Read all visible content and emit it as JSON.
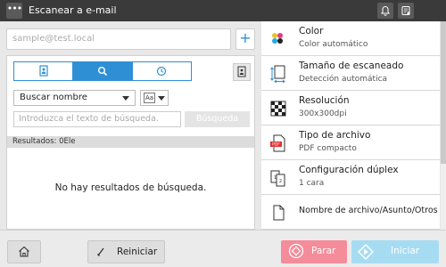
{
  "header": {
    "menu_glyph": "•••",
    "title": "Escanear a e-mail",
    "icons": [
      "bell-icon",
      "device-status-icon"
    ]
  },
  "destination": {
    "email_placeholder": "sample@test.local",
    "add_label": "+"
  },
  "search": {
    "tabs": [
      {
        "icon": "address-book-icon",
        "active": false
      },
      {
        "icon": "search-icon",
        "active": true
      },
      {
        "icon": "clock-icon",
        "active": false
      }
    ],
    "search_type": "Buscar nombre",
    "case_label": "Aa",
    "query_placeholder": "Introduzca el texto de búsqueda.",
    "search_button": "Búsqueda",
    "results_label": "Resultados: 0Ele",
    "no_results": "No hay resultados de búsqueda."
  },
  "settings": [
    {
      "name": "Color",
      "value": "Color automático",
      "icon": "color-icon"
    },
    {
      "name": "Tamaño de escaneado",
      "value": "Detección automática",
      "icon": "scan-size-icon"
    },
    {
      "name": "Resolución",
      "value": "300x300dpi",
      "icon": "resolution-icon"
    },
    {
      "name": "Tipo de archivo",
      "value": "PDF compacto",
      "icon": "file-type-icon",
      "badge": "PDF"
    },
    {
      "name": "Configuración dúplex",
      "value": "1 cara",
      "icon": "duplex-icon"
    },
    {
      "name": "Nombre de archivo/Asunto/Otros",
      "icon": "document-icon"
    }
  ],
  "footer": {
    "home_icon": "home-icon",
    "reset_label": "Reiniciar",
    "stop_label": "Parar",
    "start_label": "Iniciar"
  },
  "colors": {
    "accent": "#2f8fd5",
    "topbar": "#3a3a3a",
    "stop": "#f48c9a",
    "start": "#a6dcf2"
  }
}
